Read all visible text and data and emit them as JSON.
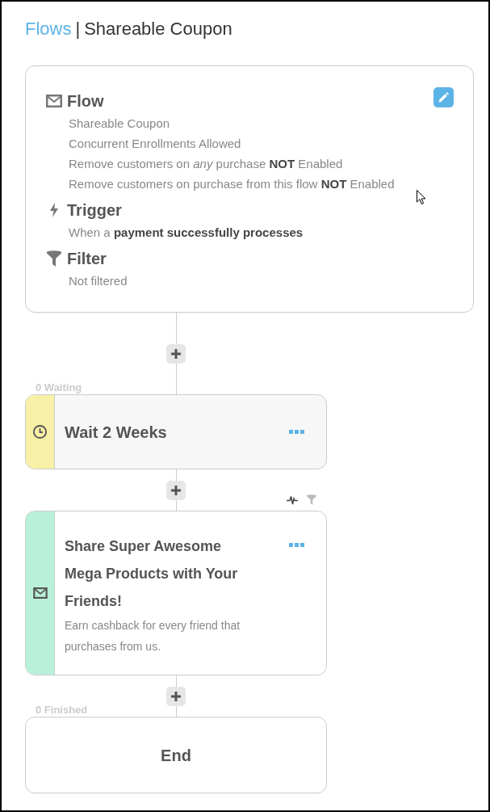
{
  "header": {
    "link": "Flows",
    "separator": "|",
    "title": "Shareable Coupon"
  },
  "summary": {
    "sections": [
      {
        "kind": "flow",
        "heading": "Flow",
        "lines": [
          "Shareable Coupon",
          "Concurrent Enrollments Allowed",
          "Remove customers on *any* purchase **NOT** Enabled",
          "Remove customers on purchase from this flow **NOT** Enabled"
        ]
      },
      {
        "kind": "trigger",
        "heading": "Trigger",
        "lines": [
          "When a **payment successfully processes**"
        ]
      },
      {
        "kind": "filter",
        "heading": "Filter",
        "lines": [
          "Not filtered"
        ]
      }
    ]
  },
  "steps": [
    {
      "kind": "wait",
      "count_label": "0 Waiting",
      "title": "Wait 2 Weeks"
    },
    {
      "kind": "email",
      "title": "Share Super Awesome Mega Products with Your Friends!",
      "description": "Earn cashback for every friend that purchases from us."
    },
    {
      "kind": "end",
      "count_label": "0 Finished",
      "title": "End"
    }
  ]
}
